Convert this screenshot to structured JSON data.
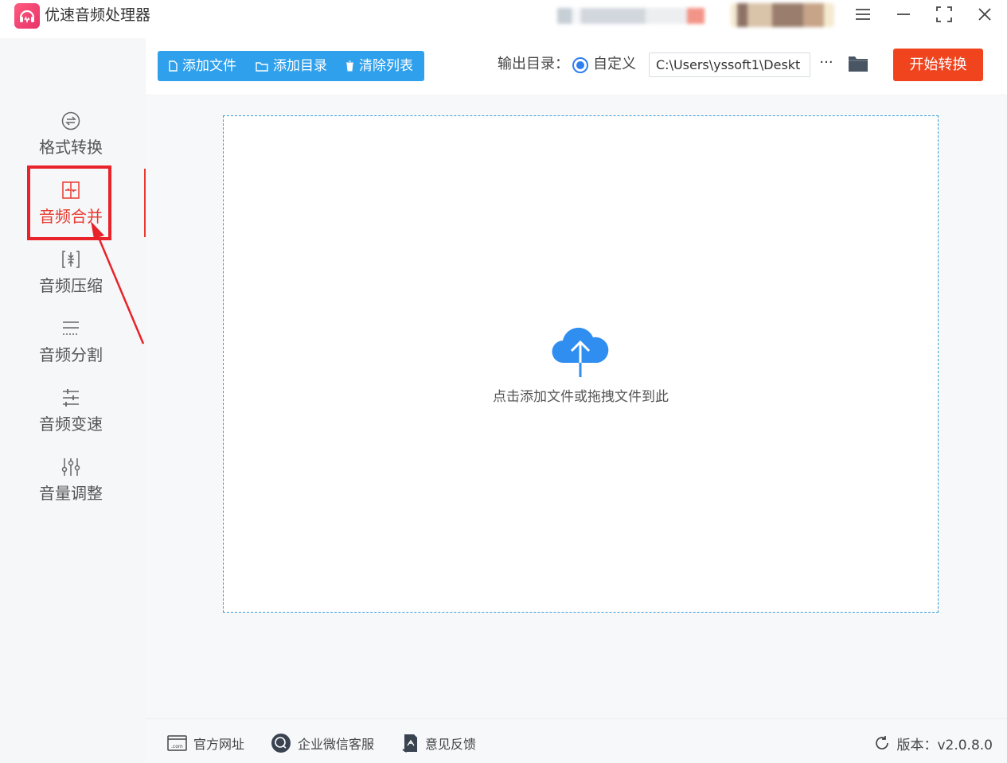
{
  "app": {
    "title": "优速音频处理器",
    "accent": "#2fa0ec",
    "start_color": "#f0441f",
    "highlight_color": "#e8232a"
  },
  "window_controls": [
    "menu-icon",
    "minimize-icon",
    "fullscreen-icon",
    "close-icon"
  ],
  "sidebar": {
    "items": [
      {
        "label": "格式转换",
        "icon": "format-convert-icon",
        "active": false
      },
      {
        "label": "音频合并",
        "icon": "audio-merge-icon",
        "active": true
      },
      {
        "label": "音频压缩",
        "icon": "audio-compress-icon",
        "active": false
      },
      {
        "label": "音频分割",
        "icon": "audio-split-icon",
        "active": false
      },
      {
        "label": "音频变速",
        "icon": "audio-speed-icon",
        "active": false
      },
      {
        "label": "音量调整",
        "icon": "volume-adjust-icon",
        "active": false
      }
    ]
  },
  "toolbar": {
    "add_file": "添加文件",
    "add_dir": "添加目录",
    "clear_list": "清除列表",
    "output_label": "输出目录：",
    "custom_option": "自定义",
    "output_path": "C:\\Users\\yssoft1\\Deskt",
    "more": "···",
    "start": "开始转换"
  },
  "dropzone": {
    "hint": "点击添加文件或拖拽文件到此"
  },
  "footer": {
    "website": "官方网址",
    "wechat": "企业微信客服",
    "feedback": "意见反馈",
    "version": "版本：v2.0.8.0"
  }
}
